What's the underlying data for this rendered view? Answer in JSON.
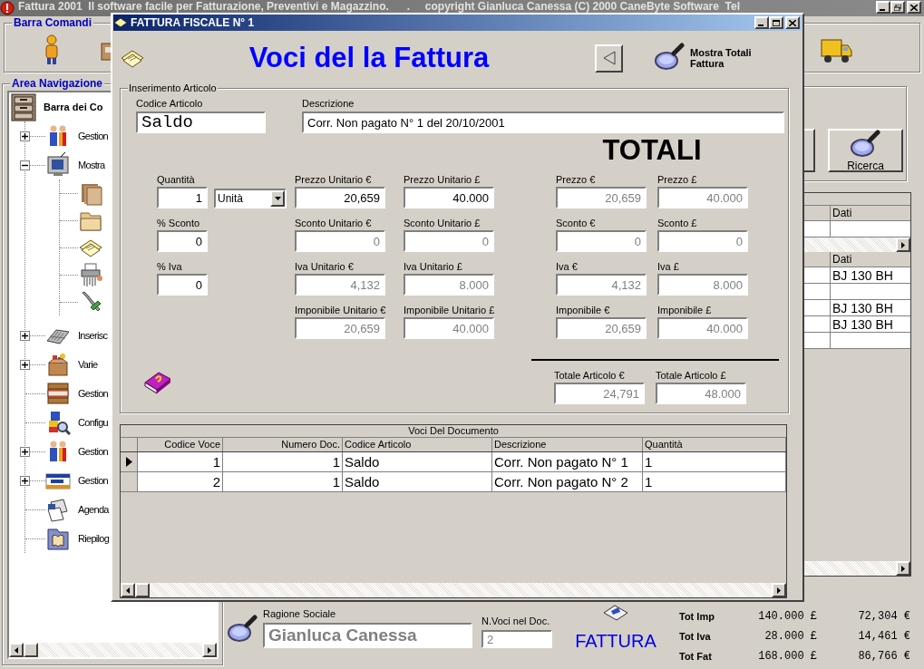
{
  "main_window": {
    "title": "Fattura 2001  Il software facile per Fatturazione, Preventivi e Magazzino.      .     copyright Gianluca Canessa (C) 2000 CaneByte Software  Tel",
    "active": false
  },
  "command_bar": {
    "title": "Barra Comandi"
  },
  "navigation": {
    "title": "Area Navigazione",
    "root": {
      "label": "Barra dei Co"
    },
    "items": [
      {
        "label": "Gestion",
        "expandable": true,
        "expanded": false
      },
      {
        "label": "Mostra",
        "expandable": true,
        "expanded": true,
        "children": [
          {
            "kind": "icon"
          },
          {
            "kind": "icon"
          },
          {
            "kind": "icon"
          },
          {
            "kind": "icon"
          },
          {
            "kind": "icon"
          }
        ]
      },
      {
        "label": "Inserisc",
        "expandable": true,
        "expanded": false
      },
      {
        "label": "Varie",
        "expandable": true,
        "expanded": false
      },
      {
        "label": "Gestion",
        "expandable": false
      },
      {
        "label": "Configu",
        "expandable": false
      },
      {
        "label": "Gestion",
        "expandable": true,
        "expanded": false
      },
      {
        "label": "Gestion",
        "expandable": true,
        "expanded": false
      },
      {
        "label": "Agenda",
        "expandable": false
      },
      {
        "label": "Riepilog",
        "expandable": false
      }
    ]
  },
  "search_panel": {
    "button": "Ricerca"
  },
  "side_grid": {
    "upper": {
      "column": "Dati",
      "rows": [
        {
          "blank": true
        }
      ]
    },
    "lower": {
      "column": "Dati",
      "rows": [
        {
          "blank": false,
          "value": "BJ 130 BH"
        },
        {
          "blank": true
        },
        {
          "blank": false,
          "value": "BJ 130 BH"
        },
        {
          "blank": false,
          "value": "BJ 130 BH"
        },
        {
          "blank": true
        }
      ]
    }
  },
  "bottom_bar": {
    "customer": {
      "label": "Ragione Sociale",
      "value": "Gianluca Canessa",
      "disabled": true
    },
    "item_count": {
      "label": "N.Voci nel Doc.",
      "value": "2",
      "disabled": true
    },
    "document_type": "FATTURA",
    "totals": [
      {
        "label": "Tot Imp",
        "lire": "140.000 £",
        "euro": "72,304 €"
      },
      {
        "label": "Tot Iva",
        "lire": "28.000 £",
        "euro": "14,461 €"
      },
      {
        "label": "Tot Fat",
        "lire": "168.000 £",
        "euro": "86,766 €"
      }
    ]
  },
  "dialog": {
    "title": "FATTURA FISCALE N° 1",
    "active": true,
    "heading": "Voci del la Fattura",
    "totals_button": "Mostra Totali Fattura",
    "group": {
      "title": "Inserimento Articolo",
      "code": {
        "label": "Codice Articolo",
        "value": "Saldo",
        "disabled": false
      },
      "description": {
        "label": "Descrizione",
        "value": "Corr. Non pagato N° 1 del 20/10/2001",
        "disabled": false
      },
      "totals_heading": "TOTALI",
      "price_rows": [
        {
          "left": {
            "label": "Quantità",
            "value": "1",
            "disabled": false
          },
          "unit": {
            "value": "Unità"
          },
          "cells": [
            {
              "label": "Prezzo Unitario €",
              "value": "20,659",
              "disabled": false
            },
            {
              "label": "Prezzo Unitario £",
              "value": "40.000",
              "disabled": false
            },
            {
              "label": "Prezzo €",
              "value": "20,659",
              "disabled": true
            },
            {
              "label": "Prezzo £",
              "value": "40.000",
              "disabled": true
            }
          ]
        },
        {
          "left": {
            "label": "% Sconto",
            "value": "0",
            "disabled": false
          },
          "cells": [
            {
              "label": "Sconto Unitario €",
              "value": "0",
              "disabled": true
            },
            {
              "label": "Sconto Unitario £",
              "value": "0",
              "disabled": true
            },
            {
              "label": "Sconto €",
              "value": "0",
              "disabled": true
            },
            {
              "label": "Sconto £",
              "value": "0",
              "disabled": true
            }
          ]
        },
        {
          "left": {
            "label": "% Iva",
            "value": "0",
            "disabled": false
          },
          "cells": [
            {
              "label": "Iva Unitario €",
              "value": "4,132",
              "disabled": true
            },
            {
              "label": "Iva Unitario £",
              "value": "8.000",
              "disabled": true
            },
            {
              "label": "Iva €",
              "value": "4,132",
              "disabled": true
            },
            {
              "label": "Iva £",
              "value": "8.000",
              "disabled": true
            }
          ]
        },
        {
          "cells": [
            {
              "label": "Imponibile Unitario €",
              "value": "20,659",
              "disabled": true
            },
            {
              "label": "Imponibile Unitario £",
              "value": "40.000",
              "disabled": true
            },
            {
              "label": "Imponibile €",
              "value": "20,659",
              "disabled": true
            },
            {
              "label": "Imponibile £",
              "value": "40.000",
              "disabled": true
            }
          ]
        }
      ],
      "article_totals": [
        {
          "label": "Totale Articolo €",
          "value": "24,791",
          "disabled": true
        },
        {
          "label": "Totale Articolo £",
          "value": "48.000",
          "disabled": true
        }
      ]
    },
    "table": {
      "caption": "Voci Del Documento",
      "columns": [
        "Codice Voce",
        "Numero Doc.",
        "Codice Articolo",
        "Descrizione",
        "Quantità"
      ],
      "rows": [
        {
          "selected": true,
          "cells": [
            "1",
            "1",
            "Saldo",
            "Corr. Non pagato N° 1",
            "1"
          ]
        },
        {
          "selected": false,
          "cells": [
            "2",
            "1",
            "Saldo",
            "Corr. Non pagato N° 2",
            "1"
          ]
        }
      ]
    }
  }
}
